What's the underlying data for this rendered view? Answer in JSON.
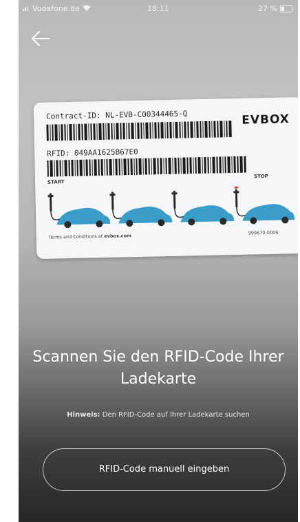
{
  "status_bar": {
    "carrier": "Vodafone.de",
    "time": "18:11",
    "battery": "27 %"
  },
  "card": {
    "contract_id": "Contract-ID: NL-EVB-C00344465-Q",
    "rfid": "RFID: 049AA1625B67E0",
    "brand": "EVBOX",
    "start_label": "START",
    "stop_label": "STOP",
    "terms_prefix": "Terms and Conditions at ",
    "terms_link": "evbox.com",
    "serial": "999670-0006"
  },
  "main": {
    "headline": "Scannen Sie den RFID-Code Ihrer Ladekarte",
    "hint_label": "Hinweis:",
    "hint_text": " Den RFID-Code auf Ihrer Ladekarte suchen",
    "manual_button_label": "RFID-Code manuell eingeben"
  },
  "icons": {
    "back": "arrow-left-icon",
    "wifi": "wifi-icon",
    "battery": "battery-icon",
    "signal": "signal-icon"
  },
  "colors": {
    "accent_red": "#e02b2b",
    "car_blue": "#3a9cc8"
  }
}
